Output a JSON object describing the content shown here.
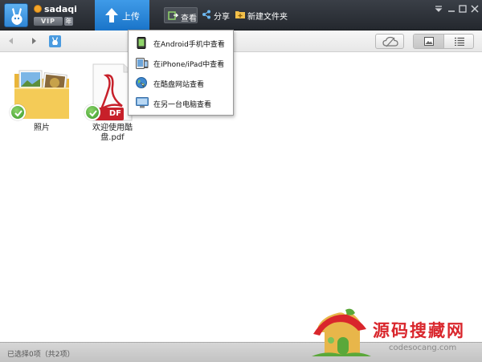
{
  "titlebar": {
    "username": "sadaqi",
    "vip_label": "VIP",
    "year_label": "年",
    "upload_label": "上传",
    "view_label": "查看",
    "share_label": "分享",
    "new_folder_label": "新建文件夹"
  },
  "dropdown": {
    "items": [
      {
        "label": "在Android手机中查看",
        "icon": "android-phone-icon"
      },
      {
        "label": "在iPhone/iPad中查看",
        "icon": "iphone-icon"
      },
      {
        "label": "在酷盘网站查看",
        "icon": "globe-icon"
      },
      {
        "label": "在另一台电脑查看",
        "icon": "monitor-icon"
      }
    ]
  },
  "files": [
    {
      "name": "照片",
      "type": "folder",
      "synced": true
    },
    {
      "name": "欢迎使用酷盘.pdf",
      "type": "pdf",
      "synced": true
    }
  ],
  "pdf_tag": "DF",
  "status": {
    "text": "已选择0项（共2项）"
  },
  "watermark": {
    "title": "源码搜藏网",
    "url": "codesocang.com"
  },
  "colors": {
    "titlebar": "#2c3036",
    "accent": "#1f7fd6",
    "pdf_red": "#c7202a",
    "check_green": "#3a9a2a"
  }
}
